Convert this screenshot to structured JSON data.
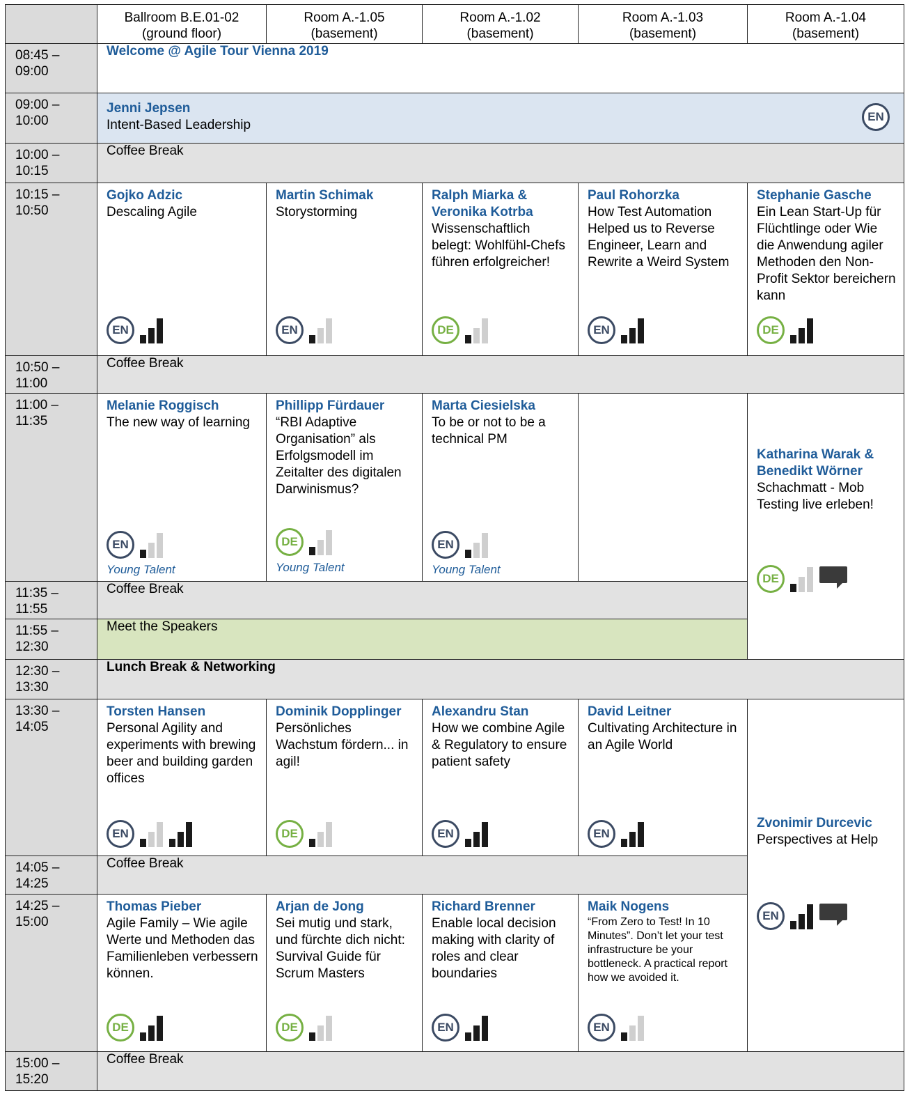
{
  "rooms": [
    {
      "name": "Ballroom B.E.01-02",
      "floor": "(ground floor)"
    },
    {
      "name": "Room A.-1.05",
      "floor": "(basement)"
    },
    {
      "name": "Room A.-1.02",
      "floor": "(basement)"
    },
    {
      "name": "Room A.-1.03",
      "floor": "(basement)"
    },
    {
      "name": "Room A.-1.04",
      "floor": "(basement)"
    }
  ],
  "times": {
    "t0845": [
      "08:45 –",
      "09:00"
    ],
    "t0900": [
      "09:00 –",
      "10:00"
    ],
    "t1000": [
      "10:00 –",
      "10:15"
    ],
    "t1015": [
      "10:15 –",
      "10:50"
    ],
    "t1050": [
      "10:50 –",
      "11:00"
    ],
    "t1100": [
      "11:00 –",
      "11:35"
    ],
    "t1135": [
      "11:35 –",
      "11:55"
    ],
    "t1155": [
      "11:55 –",
      "12:30"
    ],
    "t1230": [
      "12:30 –",
      "13:30"
    ],
    "t1330": [
      "13:30 –",
      "14:05"
    ],
    "t1405": [
      "14:05 –",
      "14:25"
    ],
    "t1425": [
      "14:25 –",
      "15:00"
    ],
    "t1500": [
      "15:00 –",
      "15:20"
    ]
  },
  "welcome": "Welcome @ Agile Tour Vienna 2019",
  "keynote": {
    "speaker": "Jenni Jepsen",
    "title": "Intent-Based Leadership",
    "lang": "EN"
  },
  "coffee_break": "Coffee Break",
  "meet_speakers": "Meet the Speakers",
  "lunch": "Lunch Break & Networking",
  "young_talent": "Young Talent",
  "s1015": [
    {
      "speaker": "Gojko Adzic",
      "title": "Descaling Agile",
      "lang": "EN"
    },
    {
      "speaker": "Martin Schimak",
      "title": "Storystorming",
      "lang": "EN"
    },
    {
      "speaker": "Ralph Miarka & Veronika Kotrba",
      "title": "Wissenschaftlich belegt: Wohlfühl-Chefs führen erfolgreicher!",
      "lang": "DE"
    },
    {
      "speaker": "Paul Rohorzka",
      "title": "How Test Automation Helped us to Reverse Engineer, Learn and Rewrite a Weird System",
      "lang": "EN"
    },
    {
      "speaker": "Stephanie Gasche",
      "title": "Ein Lean Start-Up für Flüchtlinge oder Wie die Anwendung agiler Methoden den Non-Profit Sektor bereichern kann",
      "lang": "DE"
    }
  ],
  "s1100": [
    {
      "speaker": "Melanie Roggisch",
      "title": "The new way of learning",
      "lang": "EN"
    },
    {
      "speaker": "Phillipp Fürdauer",
      "title": "“RBI Adaptive Organisation” als Erfolgsmodell im Zeitalter des digitalen Darwinismus?",
      "lang": "DE"
    },
    {
      "speaker": "Marta Ciesielska",
      "title": "To be or not to be a technical PM",
      "lang": "EN"
    }
  ],
  "workshop1": {
    "speaker": "Katharina Warak & Benedikt Wörner",
    "title": "Schachmatt - Mob Testing live erleben!",
    "lang": "DE"
  },
  "s1330": [
    {
      "speaker": "Torsten Hansen",
      "title": "Personal Agility and experiments with brewing beer and building garden offices",
      "lang": "EN"
    },
    {
      "speaker": "Dominik Dopplinger",
      "title": "Persönliches Wachstum fördern... in agil!",
      "lang": "DE"
    },
    {
      "speaker": "Alexandru Stan",
      "title": "How we combine Agile & Regulatory to ensure patient safety",
      "lang": "EN"
    },
    {
      "speaker": "David Leitner",
      "title": "Cultivating Architecture in an Agile World",
      "lang": "EN"
    }
  ],
  "workshop2": {
    "speaker": "Zvonimir Durcevic",
    "title": "Perspectives at Help",
    "lang": "EN"
  },
  "s1425": [
    {
      "speaker": "Thomas Pieber",
      "title": "Agile Family – Wie agile Werte und Methoden das Familienleben verbessern können.",
      "lang": "DE"
    },
    {
      "speaker": "Arjan de Jong",
      "title": "Sei mutig und stark, und fürchte dich nicht: Survival Guide für Scrum Masters",
      "lang": "DE"
    },
    {
      "speaker": "Richard Brenner",
      "title": "Enable local decision making with clarity of roles and clear boundaries",
      "lang": "EN"
    },
    {
      "speaker": "Maik Nogens",
      "title": "“From Zero to Test! In 10 Minutes”. Don’t let your test infrastructure be your bottleneck. A practical report how we avoided it.",
      "lang": "EN"
    }
  ]
}
